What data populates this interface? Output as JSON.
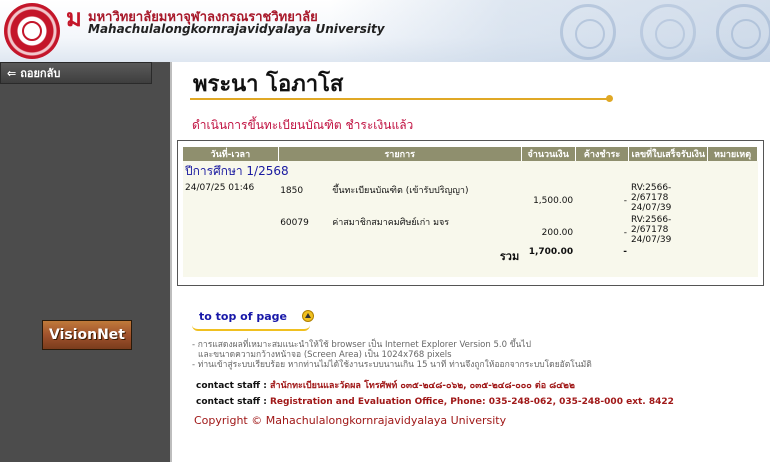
{
  "header": {
    "title_th": "มหาวิทยาลัยมหาจุฬาลงกรณราชวิทยาลัย",
    "title_en": "Mahachulalongkornrajavidyalaya University"
  },
  "sidebar": {
    "back_label": "ถอยกลับ",
    "visionnet_label": "VisionNet"
  },
  "main": {
    "student_name": "พระนา โอภาโส",
    "status": "ดำเนินการขึ้นทะเบียนบัณฑิต ชำระเงินแล้ว"
  },
  "table": {
    "headers": [
      "วันที่-เวลา",
      "รายการ",
      "จำนวนเงิน",
      "ค้างชำระ",
      "เลขที่ใบเสร็จรับเงิน",
      "หมายเหตุ"
    ],
    "term_label": "ปีการศึกษา 1/2568",
    "rows": [
      {
        "datetime": "24/07/25 01:46",
        "code": "1850",
        "item": "ขึ้นทะเบียนบัณฑิต (เข้ารับปริญญา)",
        "amount": "1,500.00",
        "outstanding": "-",
        "receipt": "RV:2566-2/67178 24/07/39",
        "note": ""
      },
      {
        "datetime": "",
        "code": "60079",
        "item": "ค่าสมาชิกสมาคมศิษย์เก่า มจร",
        "amount": "200.00",
        "outstanding": "-",
        "receipt": "RV:2566-2/67178 24/07/39",
        "note": ""
      }
    ],
    "total_label": "รวม",
    "total_amount": "1,700.00",
    "total_outstanding": "-"
  },
  "footer": {
    "top_link": "to top of page",
    "note_1": "- การแสดงผลที่เหมาะสมแนะนำให้ใช้ browser เป็น Internet Explorer Version 5.0 ขึ้นไป",
    "note_1b": "และขนาดความกว้างหน้าจอ (Screen Area) เป็น 1024x768 pixels",
    "note_2": "- ท่านเข้าสู่ระบบเรียบร้อย หากท่านไม่ได้ใช้งานระบบนานเกิน 15 นาที ท่านจึงถูกให้ออกจากระบบโดยอัตโนมัติ",
    "contact_label": "contact staff :",
    "contact_th": "สำนักทะเบียนและวัดผล โทรศัพท์ ๐๓๕-๒๔๘-๐๖๒, ๐๓๕-๒๔๘-๐๐๐ ต่อ ๘๔๒๒",
    "contact_en": "Registration and Evaluation Office, Phone: 035-248-062, 035-248-000 ext. 8422",
    "copyright_prefix": "Copyright",
    "copyright_symbol": "©",
    "copyright_text": "Mahachulalongkornrajavidyalaya University"
  },
  "colors": {
    "brand_red": "#a8182a",
    "status_pink": "#c01040",
    "sidebar": "#4c4c4c",
    "accent_gold": "#e0a825",
    "link_blue": "#1717a8"
  }
}
